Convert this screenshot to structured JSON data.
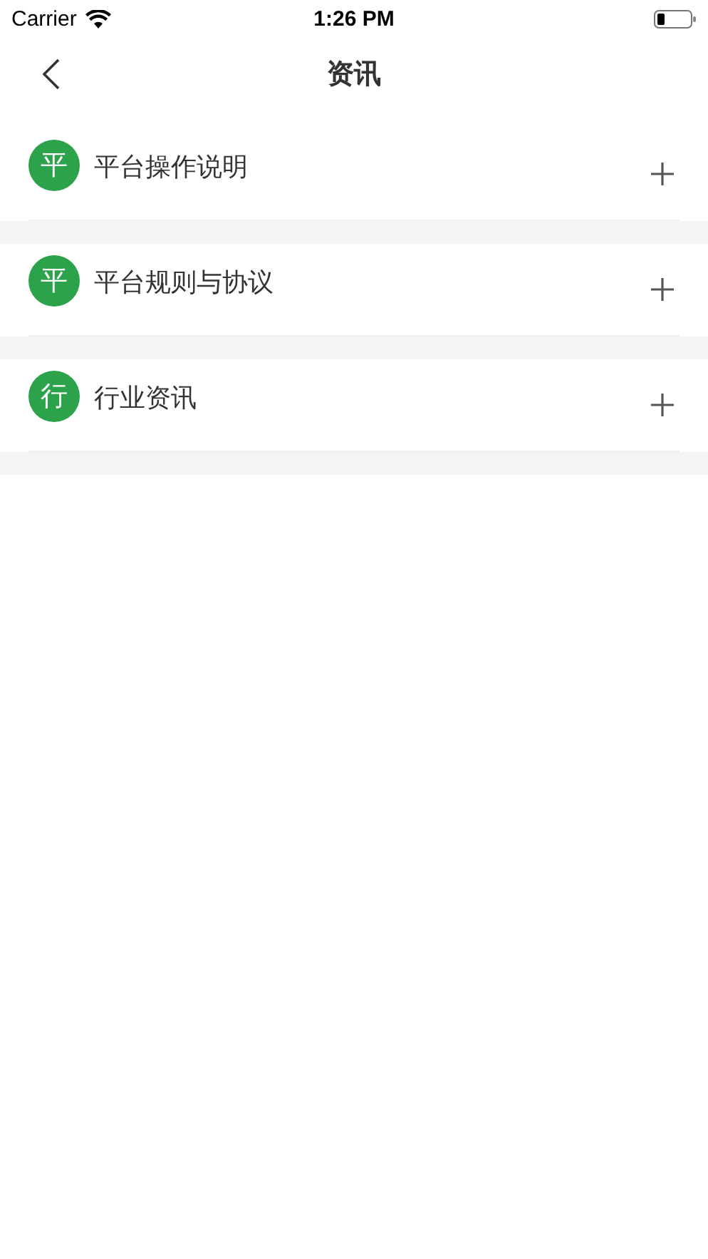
{
  "status_bar": {
    "carrier": "Carrier",
    "time": "1:26 PM"
  },
  "nav": {
    "title": "资讯"
  },
  "sections": [
    {
      "badge": "平",
      "title": "平台操作说明",
      "expanded": false
    },
    {
      "badge": "平",
      "title": "平台规则与协议",
      "expanded": false
    },
    {
      "badge": "行",
      "title": "行业资讯",
      "expanded": false
    }
  ]
}
